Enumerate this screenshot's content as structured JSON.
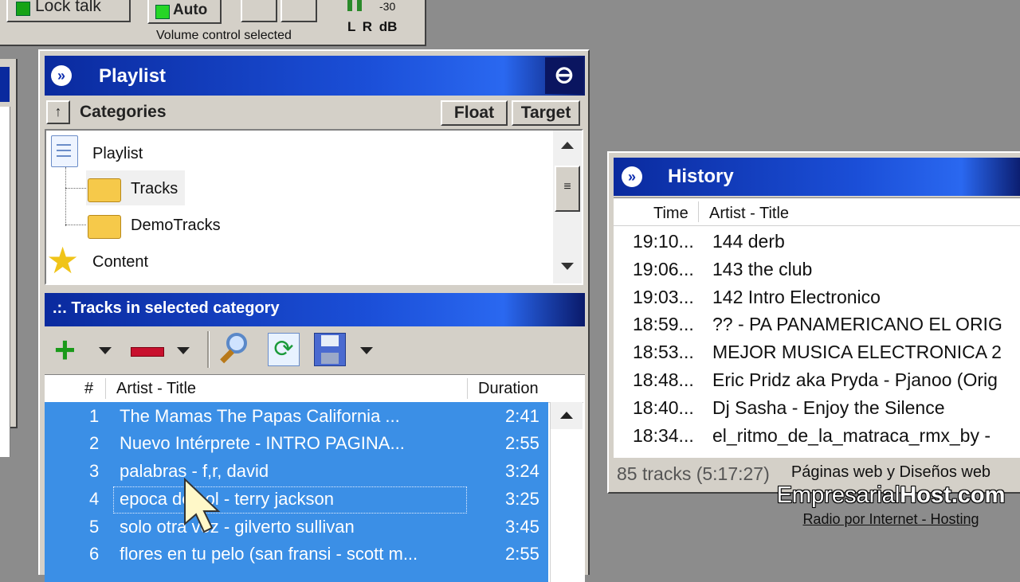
{
  "top_panel": {
    "lock_talk_label": "Lock talk",
    "auto_label": "Auto",
    "volume_status": "Volume control selected",
    "meter_db": "-30",
    "meter_labels": "L R dB"
  },
  "playlist_window": {
    "title": "Playlist",
    "categories_label": "Categories",
    "float_label": "Float",
    "target_label": "Target",
    "tree": [
      {
        "label": "Playlist",
        "icon": "document-icon"
      },
      {
        "label": "Tracks",
        "icon": "folder-icon"
      },
      {
        "label": "DemoTracks",
        "icon": "folder-icon"
      },
      {
        "label": "Content",
        "icon": "star-icon"
      }
    ],
    "tracks_title": ".:. Tracks in selected category",
    "columns": {
      "num": "#",
      "artist_title": "Artist - Title",
      "duration": "Duration"
    },
    "tracks": [
      {
        "num": "1",
        "title": "The Mamas  The Papas   California ...",
        "duration": "2:41"
      },
      {
        "num": "2",
        "title": "Nuevo Intérprete - INTRO PAGINA...",
        "duration": "2:55"
      },
      {
        "num": "3",
        "title": "palabras - f,r, david",
        "duration": "3:24"
      },
      {
        "num": "4",
        "title": "epoca de sol - terry jackson",
        "duration": "3:25"
      },
      {
        "num": "5",
        "title": "solo otra vez - gilverto sullivan",
        "duration": "3:45"
      },
      {
        "num": "6",
        "title": "flores en tu pelo (san fransi - scott m...",
        "duration": "2:55"
      }
    ]
  },
  "history_window": {
    "title": "History",
    "columns": {
      "time": "Time",
      "artist_title": "Artist - Title"
    },
    "rows": [
      {
        "time": "19:10...",
        "title": "144 derb"
      },
      {
        "time": "19:06...",
        "title": "143 the club"
      },
      {
        "time": "19:03...",
        "title": "142 Intro Electronico"
      },
      {
        "time": "18:59...",
        "title": "?? - PA PANAMERICANO EL ORIG"
      },
      {
        "time": "18:53...",
        "title": "MEJOR MUSICA ELECTRONICA 2"
      },
      {
        "time": "18:48...",
        "title": "Eric Pridz aka Pryda - Pjanoo (Orig"
      },
      {
        "time": "18:40...",
        "title": "Dj Sasha - Enjoy the Silence"
      },
      {
        "time": "18:34...",
        "title": "el_ritmo_de_la_matraca_rmx_by - "
      }
    ],
    "status": "85 tracks (5:17:27)"
  },
  "watermark": {
    "line1": "Páginas web y Diseños web",
    "brand_a": "Empresarial",
    "brand_b": "Host.com",
    "line3": "Radio por Internet - Hosting"
  }
}
